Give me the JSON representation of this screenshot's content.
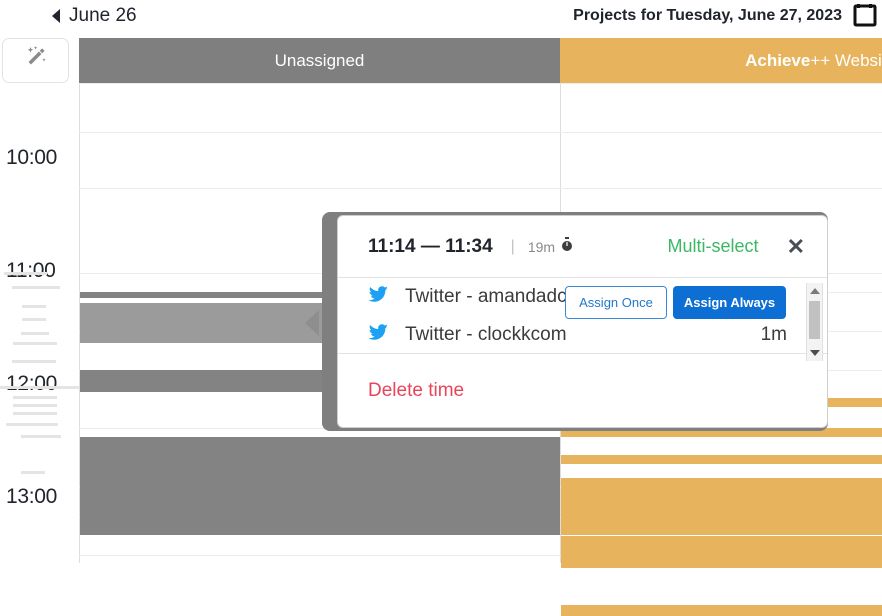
{
  "topbar": {
    "prev_day_label": "June 26",
    "prev_icon": "triangle-left-icon",
    "project_title": "Projects for Tuesday, June 27, 2023",
    "calendar_icon": "calendar-icon"
  },
  "header": {
    "wand_icon": "magic-wand-icon",
    "columns": [
      {
        "label": "Unassigned",
        "color": "#7f7f7f"
      },
      {
        "label_bold": "Achieve",
        "label_rest": "++ Website",
        "color": "#e7b45d"
      }
    ]
  },
  "timeline": {
    "hours": [
      "10:00",
      "11:00",
      "12:00",
      "13:00"
    ]
  },
  "popup": {
    "time_range": "11:14 — 11:34",
    "separator": "|",
    "duration": "19m",
    "timer_icon": "stopwatch-icon",
    "multi_select_label": "Multi-select",
    "multi_select_color": "#3bb863",
    "close_icon": "close-icon",
    "rows": [
      {
        "icon": "twitter-icon",
        "label": "Twitter - amandadc",
        "time": ""
      },
      {
        "icon": "twitter-icon",
        "label": "Twitter - clockkcom",
        "time": "1m"
      }
    ],
    "assign_once_label": "Assign Once",
    "assign_always_label": "Assign Always",
    "delete_label": "Delete time",
    "delete_color": "#e8455a",
    "scrollbar": {
      "up_icon": "arrow-up-icon",
      "down_icon": "arrow-down-icon"
    }
  }
}
